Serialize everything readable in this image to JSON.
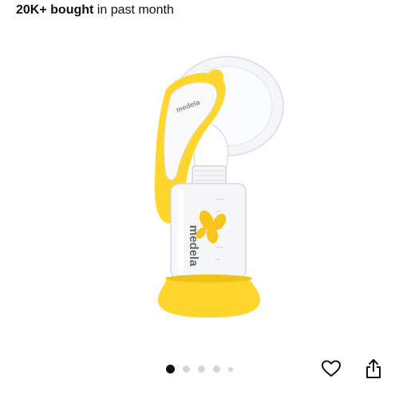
{
  "social_proof": {
    "count": "20K+ bought",
    "suffix": " in past month"
  },
  "product_image": {
    "brand_label": "medela",
    "alt": "Medela Harmony manual breast pump with yellow handle and bottle"
  },
  "carousel": {
    "total": 5,
    "active_index": 0
  },
  "colors": {
    "accent_yellow": "#ffd62e",
    "active_dot": "#111111",
    "inactive_dot": "#d5d5d5"
  },
  "icons": {
    "wishlist": "heart-outline-icon",
    "share": "share-icon"
  }
}
